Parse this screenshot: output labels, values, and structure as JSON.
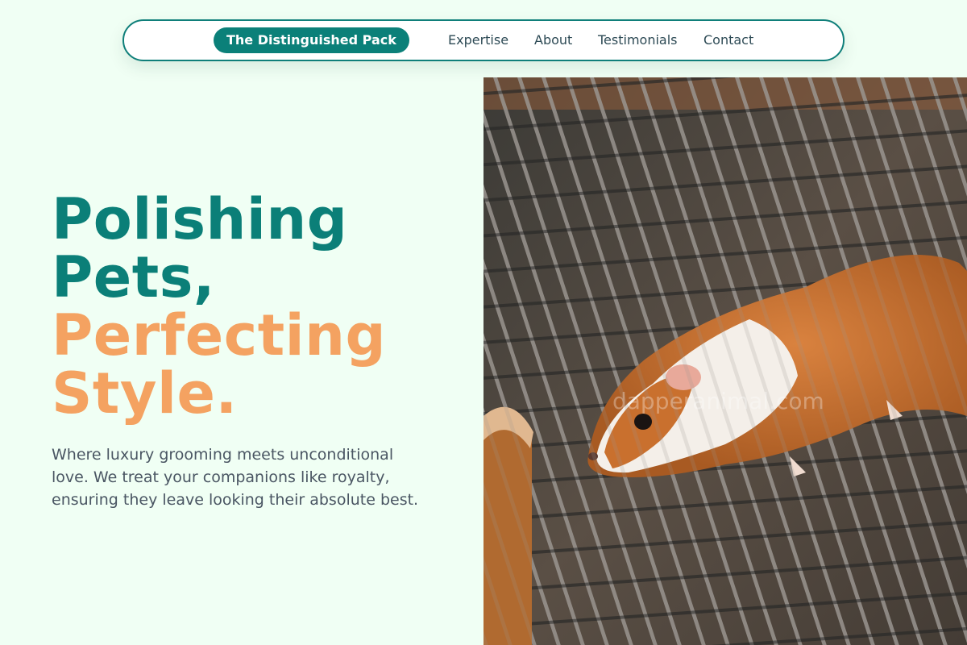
{
  "nav": {
    "brand": "The Distinguished Pack",
    "links": [
      "Expertise",
      "About",
      "Testimonials",
      "Contact"
    ]
  },
  "hero": {
    "title_lines": [
      "Polishing",
      "Pets,",
      "Perfecting",
      "Style."
    ],
    "subtitle": "Where luxury grooming meets unconditional love. We treat your companions like royalty, ensuring they leave looking their absolute best.",
    "image": {
      "subject": "guinea pig on a wire cage grate",
      "watermark": "dapperanimal.com"
    }
  },
  "colors": {
    "background": "#f0fff4",
    "teal": "#0b7f78",
    "orange": "#f4a261",
    "text": "#4a5663"
  }
}
